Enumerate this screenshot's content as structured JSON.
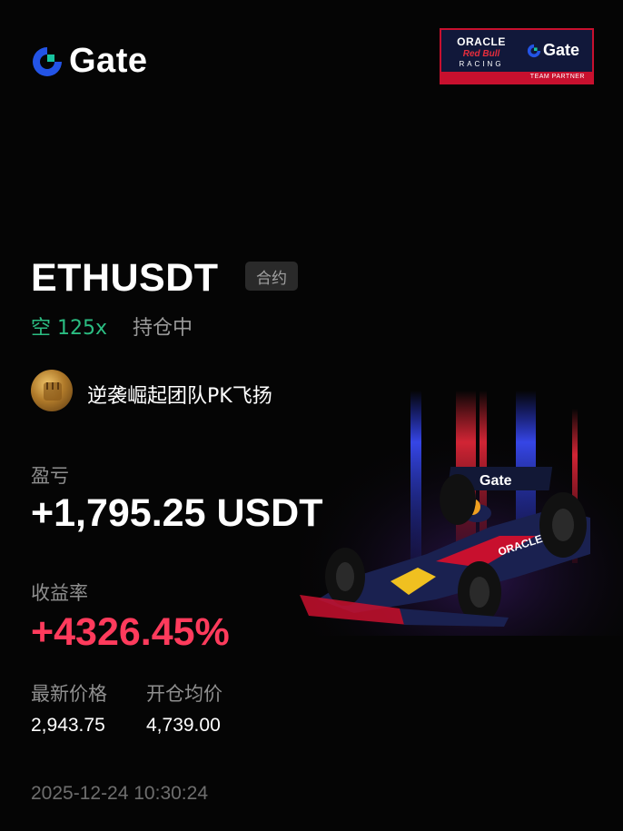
{
  "brand": {
    "name": "Gate",
    "accent": "#2354e6",
    "accent2": "#18c4a0"
  },
  "partner": {
    "oracle": "ORACLE",
    "redbull": "Red Bull",
    "racing": "RACING",
    "gate": "Gate",
    "tagline": "TEAM PARTNER"
  },
  "position": {
    "pair": "ETHUSDT",
    "type_tag": "合约",
    "direction": "空 125x",
    "status": "持仓中"
  },
  "team": {
    "name": "逆袭崛起团队PK飞扬"
  },
  "pnl": {
    "label": "盈亏",
    "value": "+1,795.25 USDT"
  },
  "roi": {
    "label": "收益率",
    "value": "+4326.45%"
  },
  "prices": {
    "last_label": "最新价格",
    "last_value": "2,943.75",
    "entry_label": "开仓均价",
    "entry_value": "4,739.00"
  },
  "timestamp": "2025-12-24 10:30:24",
  "colors": {
    "green": "#2bbd82",
    "red": "#ff3b5c",
    "muted": "#8f8f8f"
  },
  "car_livery": {
    "wing_text": "Gate",
    "sidepod_text": "ORACLE"
  }
}
